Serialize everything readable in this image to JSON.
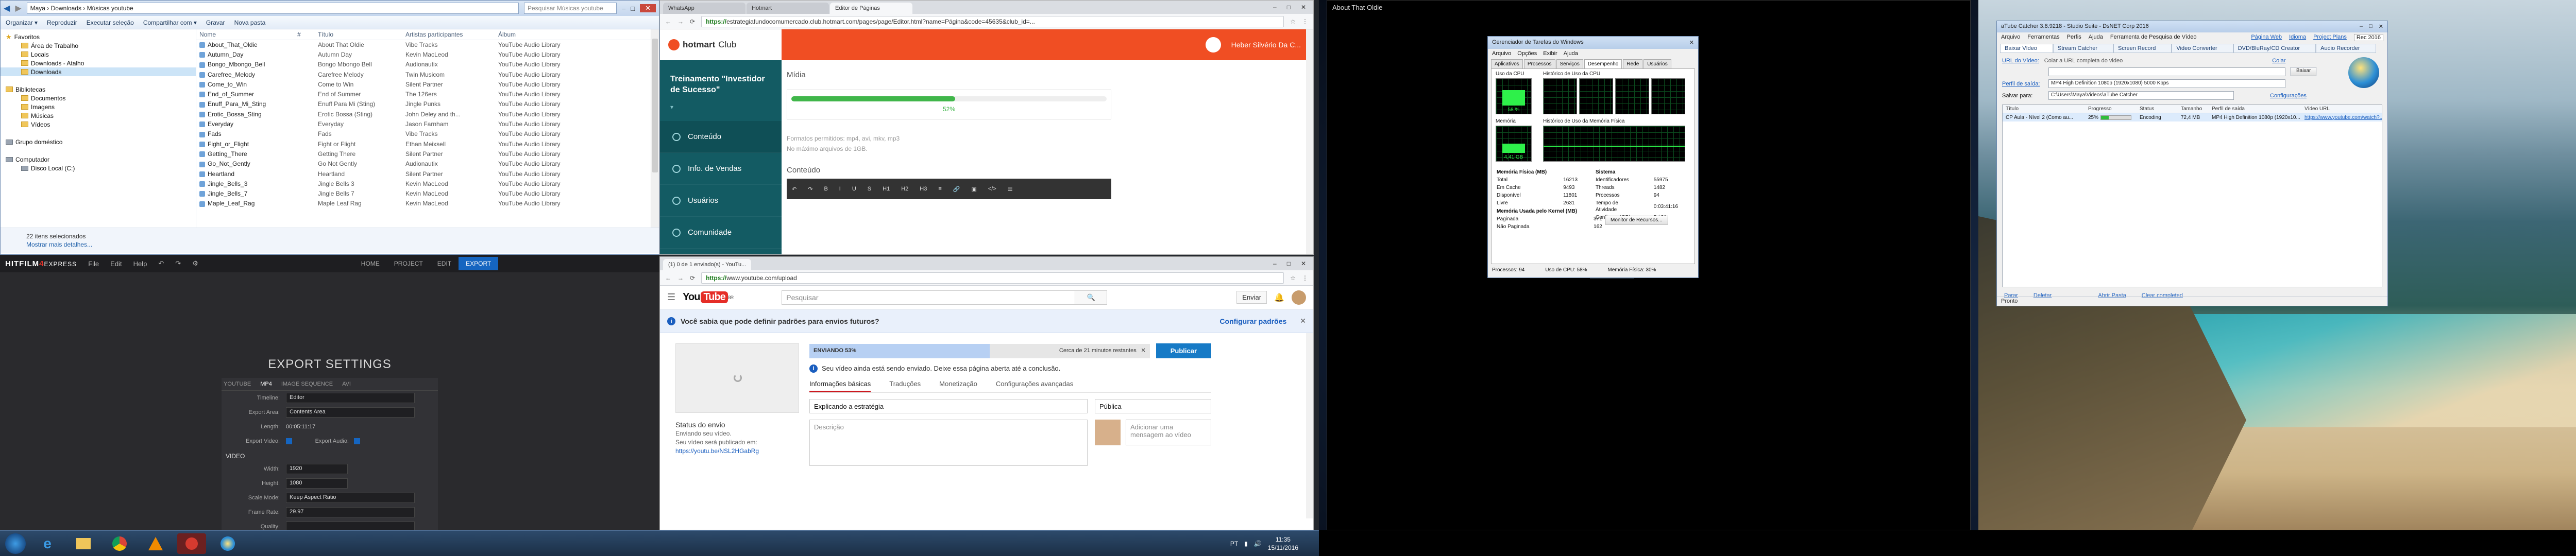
{
  "explorer": {
    "address": "Maya › Downloads › Músicas youtube",
    "search_placeholder": "Pesquisar Músicas youtube",
    "toolbar": [
      "Organizar ▾",
      "Reproduzir",
      "Executar seleção",
      "Compartilhar com ▾",
      "Gravar",
      "Nova pasta"
    ],
    "nav_favorites": [
      "Favoritos",
      "Área de Trabalho",
      "Locais",
      "Downloads - Atalho",
      "Downloads"
    ],
    "nav_libraries": [
      "Bibliotecas",
      "Documentos",
      "Imagens",
      "Músicas",
      "Vídeos"
    ],
    "nav_other": [
      "Grupo doméstico",
      "Computador",
      "Disco Local (C:)"
    ],
    "columns": [
      "Nome",
      "#",
      "Título",
      "Artistas participantes",
      "Álbum"
    ],
    "files": [
      [
        "About_That_Oldie",
        "",
        "About That Oldie",
        "Vibe Tracks",
        "YouTube Audio Library"
      ],
      [
        "Autumn_Day",
        "",
        "Autumn Day",
        "Kevin MacLeod",
        "YouTube Audio Library"
      ],
      [
        "Bongo_Mbongo_Bell",
        "",
        "Bongo Mbongo Bell",
        "Audionautix",
        "YouTube Audio Library"
      ],
      [
        "Carefree_Melody",
        "",
        "Carefree Melody",
        "Twin Musicom",
        "YouTube Audio Library"
      ],
      [
        "Come_to_Win",
        "",
        "Come to Win",
        "Silent Partner",
        "YouTube Audio Library"
      ],
      [
        "End_of_Summer",
        "",
        "End of Summer",
        "The 126ers",
        "YouTube Audio Library"
      ],
      [
        "Enuff_Para_Mi_Sting",
        "",
        "Enuff Para Mi (Sting)",
        "Jingle Punks",
        "YouTube Audio Library"
      ],
      [
        "Erotic_Bossa_Sting",
        "",
        "Erotic Bossa (Sting)",
        "John Deley and th...",
        "YouTube Audio Library"
      ],
      [
        "Everyday",
        "",
        "Everyday",
        "Jason Farnham",
        "YouTube Audio Library"
      ],
      [
        "Fads",
        "",
        "Fads",
        "Vibe Tracks",
        "YouTube Audio Library"
      ],
      [
        "Fight_or_Flight",
        "",
        "Fight or Flight",
        "Ethan Meixsell",
        "YouTube Audio Library"
      ],
      [
        "Getting_There",
        "",
        "Getting There",
        "Silent Partner",
        "YouTube Audio Library"
      ],
      [
        "Go_Not_Gently",
        "",
        "Go Not Gently",
        "Audionautix",
        "YouTube Audio Library"
      ],
      [
        "Heartland",
        "",
        "Heartland",
        "Silent Partner",
        "YouTube Audio Library"
      ],
      [
        "Jingle_Bells_3",
        "",
        "Jingle Bells 3",
        "Kevin MacLeod",
        "YouTube Audio Library"
      ],
      [
        "Jingle_Bells_7",
        "",
        "Jingle Bells 7",
        "Kevin MacLeod",
        "YouTube Audio Library"
      ],
      [
        "Maple_Leaf_Rag",
        "",
        "Maple Leaf Rag",
        "Kevin MacLeod",
        "YouTube Audio Library"
      ]
    ],
    "status_line1": "22 itens selecionados",
    "status_line2": "Mostrar mais detalhes..."
  },
  "hitfilm": {
    "logo_white": "HITFILM",
    "logo_red": "4",
    "logo_tail": "EXPRESS",
    "menu": [
      "File",
      "Edit",
      "Help"
    ],
    "tabs": [
      "HOME",
      "PROJECT",
      "EDIT",
      "EXPORT"
    ],
    "active_tab": "EXPORT",
    "heading": "EXPORT SETTINGS",
    "subtabs": [
      "YOUTUBE",
      "MP4",
      "IMAGE SEQUENCE",
      "AVI"
    ],
    "active_subtab": "MP4",
    "fields": [
      {
        "label": "Timeline:",
        "value": "Editor"
      },
      {
        "label": "Export Area:",
        "value": "Contents Area"
      },
      {
        "label": "Length:",
        "value": "00:05:11:17"
      }
    ],
    "export_video_label": "Export Video:",
    "export_audio_label": "Export Audio:",
    "video_section": "VIDEO",
    "video_fields": [
      {
        "label": "Width:",
        "value": "1920"
      },
      {
        "label": "Height:",
        "value": "1080"
      },
      {
        "label": "Scale Mode:",
        "value": "Keep Aspect Ratio"
      },
      {
        "label": "Frame Rate:",
        "value": "29.97"
      }
    ],
    "quality_label": "Quality:"
  },
  "chrome_hotmart": {
    "tabs": [
      "WhatsApp",
      "Hotmart",
      "Editor de Páginas"
    ],
    "active_tab": 2,
    "url_secure": "https://",
    "url_rest": "estrategiafundocomumercado.club.hotmart.com/pages/page/Editor.html?name=Página&code=45635&club_id=...",
    "brand": "hotmart",
    "brand_suffix": "Club",
    "user_name": "Heber Silvério Da C...",
    "course_title": "Treinamento \"Investidor de Sucesso\"",
    "sidebar": [
      "Conteúdo",
      "Info. de Vendas",
      "Usuários",
      "Comunidade"
    ],
    "media_label": "Mídia",
    "progress_text": "52%",
    "progress_value": 0.52,
    "formats_hint": "Formatos permitidos: mp4, avi, mkv, mp3",
    "size_hint": "No máximo arquivos de 1GB.",
    "content_label": "Conteúdo"
  },
  "chrome_youtube": {
    "tabs": [
      "(1) 0 de 1 enviado(s) - YouTu..."
    ],
    "url_secure": "https://",
    "url_rest": "www.youtube.com/upload",
    "logo_you": "You",
    "logo_tube": "Tube",
    "logo_country": "BR",
    "search_placeholder": "Pesquisar",
    "upload_button": "Enviar",
    "banner_text": "Você sabia que pode definir padrões para envios futuros?",
    "banner_link": "Configurar padrões",
    "sending_label": "ENVIANDO 53%",
    "sending_progress": 0.53,
    "time_left": "Cerca de 21 minutos restantes",
    "publish_button": "Publicar",
    "sending_note": "Seu vídeo ainda está sendo enviado. Deixe essa página aberta até a conclusão.",
    "info_tabs": [
      "Informações básicas",
      "Traduções",
      "Monetização",
      "Configurações avançadas"
    ],
    "title_value": "Explicando a estratégia",
    "visibility": "Pública",
    "description_placeholder": "Descrição",
    "message_placeholder": "Adicionar uma mensagem ao vídeo",
    "status_heading": "Status do envio",
    "status_detail": "Enviando seu vídeo.",
    "status_link_label": "Seu vídeo será publicado em:",
    "status_link": "https://youtu.be/NSL2HGabRg"
  },
  "black_window": {
    "title": "About That Oldie"
  },
  "task_manager": {
    "title": "Gerenciador de Tarefas do Windows",
    "menu": [
      "Arquivo",
      "Opções",
      "Exibir",
      "Ajuda"
    ],
    "tabs": [
      "Aplicativos",
      "Processos",
      "Serviços",
      "Desempenho",
      "Rede",
      "Usuários"
    ],
    "active_tab": "Desempenho",
    "cpu_label": "Uso da CPU",
    "cpu_history_label": "Histórico de Uso da CPU",
    "cpu_value": "58 %",
    "mem_label": "Memória",
    "mem_history_label": "Histórico de Uso da Memória Física",
    "mem_value": "4,41 GB",
    "phys_mem": [
      [
        "Memória Física (MB)",
        ""
      ],
      [
        "Total",
        "16213"
      ],
      [
        "Em Cache",
        "9493"
      ],
      [
        "Disponível",
        "11801"
      ],
      [
        "Livre",
        "2631"
      ]
    ],
    "system": [
      [
        "Sistema",
        ""
      ],
      [
        "Identificadores",
        "55975"
      ],
      [
        "Threads",
        "1482"
      ],
      [
        "Processos",
        "94"
      ],
      [
        "Tempo de Atividade",
        "0:03:41:16"
      ],
      [
        "Confirmar (GB)",
        "5 / 31"
      ]
    ],
    "kernel": [
      [
        "Memória Usada pelo Kernel (MB)",
        ""
      ],
      [
        "Paginada",
        "371"
      ],
      [
        "Não Paginada",
        "162"
      ]
    ],
    "resmon_button": "Monitor de Recursos...",
    "status": [
      "Processos: 94",
      "Uso de CPU: 58%",
      "Memória Física: 30%"
    ]
  },
  "ytcatcher": {
    "title": "aTube Catcher 3.8.9218 - Studio Suite - DsNET Corp 2016",
    "menu": [
      "Arquivo",
      "Ferramentas",
      "Perfis",
      "Ajuda",
      "Ferramenta de Pesquisa de Vídeo"
    ],
    "top_links": [
      "Página Web",
      "Idioma",
      "Project Plans",
      "Rec 2016"
    ],
    "tabs": [
      "Baixar Vídeo",
      "Stream Catcher",
      "Screen Record",
      "Video Converter",
      "DVD/BluRay/CD Creator",
      "Audio Recorder"
    ],
    "url_label": "URL do Vídeo:",
    "url_hint": "Colar a URL completa do video",
    "paste_link": "Colar",
    "download_button": "Baixar",
    "profile_label": "Perfil de saída:",
    "profile_value": "MP4 High Definition 1080p (1920x1080) 5000 Kbps",
    "save_label": "Salvar para:",
    "save_value": "C:\\Users\\Maya\\Videos\\aTube Catcher",
    "settings_link": "Configurações",
    "columns": [
      "Título",
      "Progresso",
      "Status",
      "Tamanho",
      "Perfil de saída",
      "Vídeo URL"
    ],
    "rows": [
      {
        "title": "CP Aula - Nível 2 (Como au...",
        "progress_text": "25%",
        "progress": 0.25,
        "status": "Encoding",
        "size": "72,4 MB",
        "profile": "MP4 High Definition 1080p (1920x10...",
        "url": "https://www.youtube.com/watch?..."
      }
    ],
    "bottom_actions": [
      "Parar",
      "Deletar",
      "Abrir Pasta",
      "Clear completed"
    ],
    "status_bar": "Pronto"
  },
  "taskbar": {
    "apps": [
      "windows-logo",
      "ie",
      "explorer",
      "chrome",
      "vlc",
      "hitfilm",
      "atube"
    ],
    "clock_time": "11:35",
    "clock_date": "15/11/2016",
    "lang": "PT"
  },
  "colors": {
    "hotmart_orange": "#f04e23",
    "hotmart_teal": "#135b63",
    "youtube_red": "#e52d27",
    "hitfilm_blue": "#1565c0",
    "progress_green": "#2fbd3a"
  }
}
